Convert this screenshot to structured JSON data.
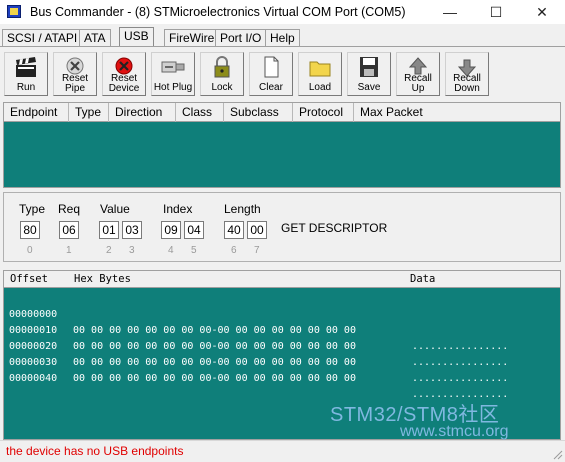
{
  "window": {
    "title": "Bus Commander - (8) STMicroelectronics Virtual COM Port (COM5)",
    "controls": {
      "minimize": "—",
      "maximize": "☐",
      "close": "✕"
    }
  },
  "tabs": [
    {
      "label": "SCSI / ATAPI",
      "active": false
    },
    {
      "label": "ATA",
      "active": false
    },
    {
      "label": "USB",
      "active": true
    },
    {
      "label": "FireWire",
      "active": false
    },
    {
      "label": "Port I/O",
      "active": false
    },
    {
      "label": "Help",
      "active": false
    }
  ],
  "toolbar": {
    "run": "Run",
    "reset_pipe_1": "Reset",
    "reset_pipe_2": "Pipe",
    "reset_device_1": "Reset",
    "reset_device_2": "Device",
    "hot_plug": "Hot Plug",
    "lock": "Lock",
    "clear": "Clear",
    "load": "Load",
    "save": "Save",
    "recall_up_1": "Recall",
    "recall_up_2": "Up",
    "recall_down_1": "Recall",
    "recall_down_2": "Down"
  },
  "endpoint_table": {
    "columns": [
      "Endpoint",
      "Type",
      "Direction",
      "Class",
      "Subclass",
      "Protocol",
      "Max Packet"
    ],
    "rows": []
  },
  "setup_packet": {
    "type_label": "Type",
    "req_label": "Req",
    "value_label": "Value",
    "index_label": "Index",
    "length_label": "Length",
    "bytes": [
      "80",
      "06",
      "01",
      "03",
      "09",
      "04",
      "40",
      "00"
    ],
    "byte_indexes": [
      "0",
      "1",
      "2",
      "3",
      "4",
      "5",
      "6",
      "7"
    ],
    "request_name": "GET DESCRIPTOR"
  },
  "hex_dump": {
    "headers": {
      "offset": "Offset",
      "hex": "Hex Bytes",
      "data": "Data"
    },
    "rows": [
      {
        "offset": "00000000",
        "bytes": "00 00 00 00 00 00 00 00-00 00 00 00 00 00 00 00",
        "ascii": "................"
      },
      {
        "offset": "00000010",
        "bytes": "00 00 00 00 00 00 00 00-00 00 00 00 00 00 00 00",
        "ascii": "................"
      },
      {
        "offset": "00000020",
        "bytes": "00 00 00 00 00 00 00 00-00 00 00 00 00 00 00 00",
        "ascii": "................"
      },
      {
        "offset": "00000030",
        "bytes": "00 00 00 00 00 00 00 00-00 00 00 00 00 00 00 00",
        "ascii": "................"
      },
      {
        "offset": "00000040",
        "bytes": "",
        "ascii": ""
      }
    ]
  },
  "watermark": {
    "line1": "STM32/STM8社区",
    "line2": "www.stmcu.org"
  },
  "status": {
    "message": "the device has no USB endpoints"
  },
  "colors": {
    "panel_bg": "#0f7f7a",
    "status_text": "#e00000",
    "window_bg": "#f0f0f0"
  }
}
